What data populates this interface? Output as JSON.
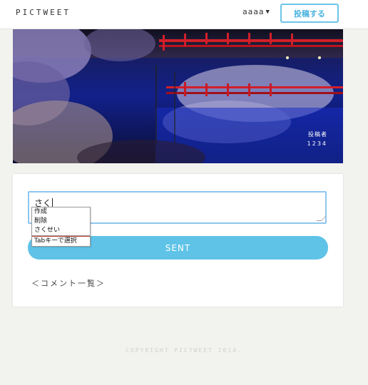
{
  "header": {
    "logo": "PICTWEET",
    "username": "aaaa",
    "post_button": "投稿する"
  },
  "photo": {
    "poster_label": "投稿者",
    "poster_name": "1234"
  },
  "comment_form": {
    "typed_text": "さく",
    "submit_label": "SENT",
    "comment_list_link": "＜コメント一覧＞"
  },
  "ime": {
    "candidates": [
      "作成",
      "削除",
      "さくせい"
    ],
    "hint": "Tabキーで選択"
  },
  "footer": {
    "copyright": "COPYRIGHT PICTWEET 2014."
  }
}
